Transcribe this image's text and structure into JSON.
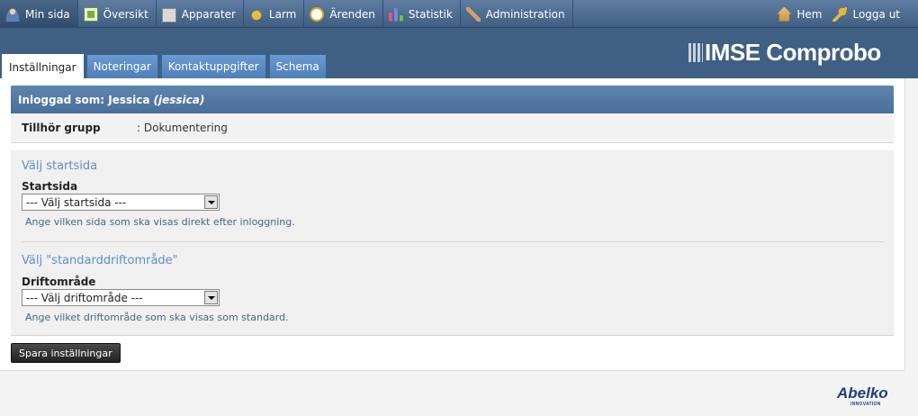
{
  "nav": {
    "items": [
      {
        "label": "Min sida",
        "icon": "user-icon"
      },
      {
        "label": "Översikt",
        "icon": "overview-icon"
      },
      {
        "label": "Apparater",
        "icon": "devices-icon"
      },
      {
        "label": "Larm",
        "icon": "alarm-icon"
      },
      {
        "label": "Ärenden",
        "icon": "clock-icon"
      },
      {
        "label": "Statistik",
        "icon": "statistics-icon"
      },
      {
        "label": "Administration",
        "icon": "wrench-icon"
      }
    ],
    "right": [
      {
        "label": "Hem",
        "icon": "home-icon"
      },
      {
        "label": "Logga ut",
        "icon": "key-icon"
      }
    ]
  },
  "brand": {
    "logo_text": "IMSE Comprobo"
  },
  "tabs": [
    {
      "label": "Inställningar"
    },
    {
      "label": "Noteringar"
    },
    {
      "label": "Kontaktuppgifter"
    },
    {
      "label": "Schema"
    }
  ],
  "user_bar": {
    "prefix": "Inloggad som: Jessica",
    "username": "(jessica)"
  },
  "group": {
    "label": "Tillhör grupp",
    "value": ": Dokumentering"
  },
  "startpage": {
    "title": "Välj startsida",
    "field_label": "Startsida",
    "selected": "--- Välj startsida ---",
    "hint": "Ange vilken sida som ska visas direkt efter inloggning."
  },
  "area": {
    "title": "Välj \"standarddriftområde\"",
    "field_label": "Driftområde",
    "selected": "--- Välj driftområde ---",
    "hint": "Ange vilket driftområde som ska visas som standard."
  },
  "save_label": "Spara inställningar",
  "footer": {
    "brand": "Abelko",
    "brand_sub": "INNOVATION"
  }
}
